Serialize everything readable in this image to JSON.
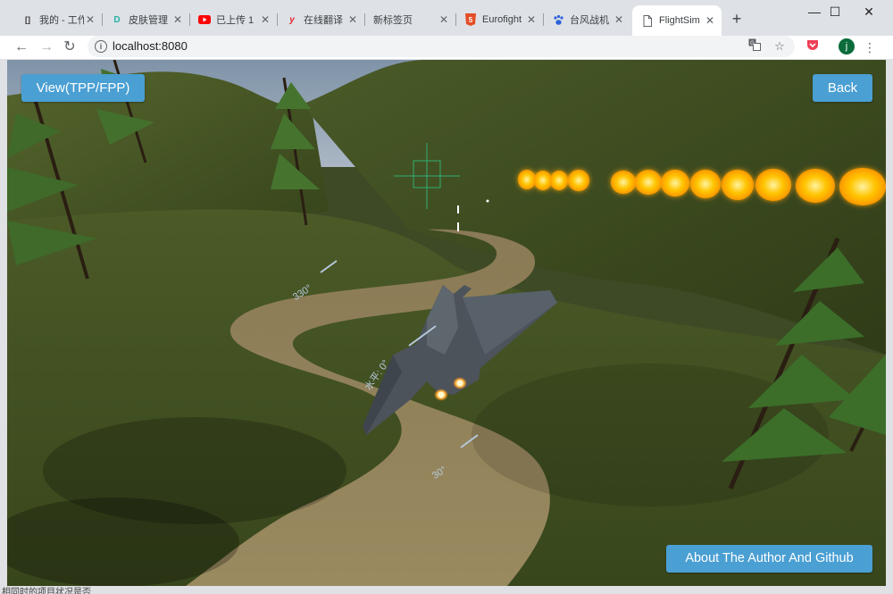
{
  "browser": {
    "tabs": [
      {
        "title": "我的 - 工作",
        "icon": "bracket-icon"
      },
      {
        "title": "皮肤管理",
        "icon": "d-logo-icon"
      },
      {
        "title": "已上传 1",
        "icon": "youtube-icon"
      },
      {
        "title": "在线翻译",
        "icon": "y-logo-icon"
      },
      {
        "title": "新标签页",
        "icon": ""
      },
      {
        "title": "Eurofight",
        "icon": "html5-icon"
      },
      {
        "title": "台风战机",
        "icon": "paw-icon"
      },
      {
        "title": "FlightSim",
        "icon": "document-icon"
      }
    ],
    "active_tab": 7,
    "url": "localhost:8080",
    "profile_initial": "j"
  },
  "game": {
    "buttons": {
      "view": "View(TPP/FPP)",
      "back": "Back",
      "about": "About The Author And Github"
    },
    "hud": {
      "pitch_upper": "330°",
      "pitch_level": "水平: 0°",
      "pitch_lower": "30°"
    }
  },
  "status_text": "相同时的项目状况是否"
}
